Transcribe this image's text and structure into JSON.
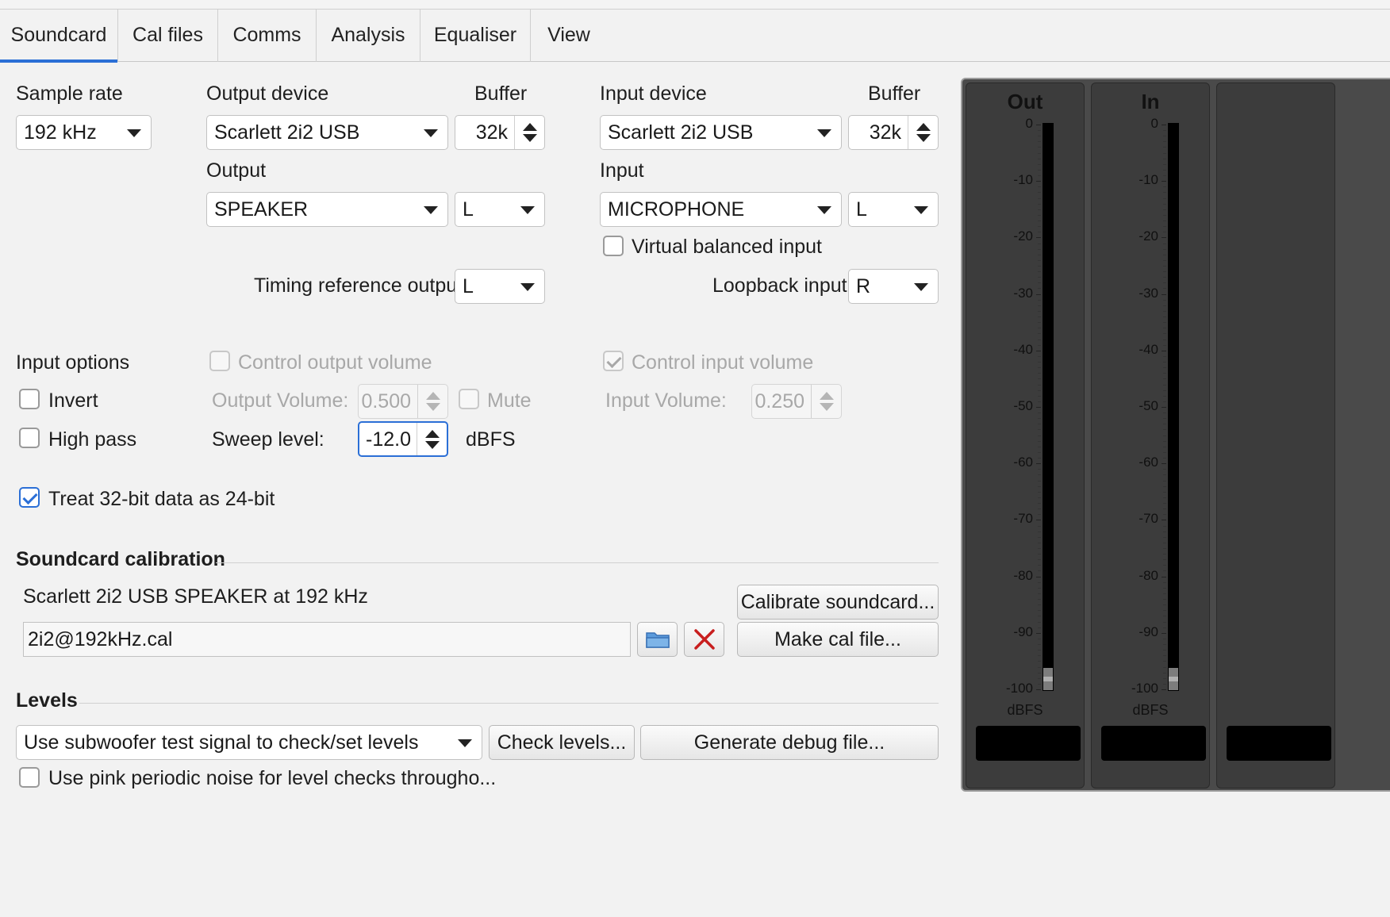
{
  "tabs": [
    "Soundcard",
    "Cal files",
    "Comms",
    "Analysis",
    "Equaliser",
    "View"
  ],
  "sample_rate": {
    "label": "Sample rate",
    "value": "192 kHz"
  },
  "output_device": {
    "label": "Output device",
    "value": "Scarlett 2i2 USB",
    "buffer_label": "Buffer",
    "buffer": "32k"
  },
  "input_device": {
    "label": "Input device",
    "value": "Scarlett 2i2 USB",
    "buffer_label": "Buffer",
    "buffer": "32k"
  },
  "output": {
    "label": "Output",
    "value": "SPEAKER",
    "channel": "L"
  },
  "input": {
    "label": "Input",
    "value": "MICROPHONE",
    "channel": "L"
  },
  "virtual_balanced": {
    "label": "Virtual balanced input",
    "checked": false
  },
  "timing_ref": {
    "label": "Timing reference output",
    "value": "L"
  },
  "loopback": {
    "label": "Loopback input",
    "value": "R"
  },
  "input_options": {
    "label": "Input options",
    "invert": "Invert",
    "high_pass": "High pass",
    "treat_32bit": "Treat 32-bit data as 24-bit"
  },
  "volume": {
    "control_output": "Control output volume",
    "output_volume_label": "Output Volume:",
    "output_volume": "0.500",
    "mute": "Mute",
    "sweep_label": "Sweep level:",
    "sweep_value": "-12.0",
    "sweep_unit": "dBFS",
    "control_input": "Control input volume",
    "input_volume_label": "Input Volume:",
    "input_volume": "0.250"
  },
  "calibration": {
    "heading": "Soundcard calibration",
    "description": "Scarlett 2i2 USB SPEAKER at 192 kHz",
    "calibrate_button": "Calibrate soundcard...",
    "file": "2i2@192kHz.cal",
    "make_button": "Make cal file...",
    "folder_icon": "folder-icon",
    "clear_icon": "close-icon"
  },
  "levels": {
    "heading": "Levels",
    "signal": "Use subwoofer test signal to check/set levels",
    "check_button": "Check levels...",
    "debug_button": "Generate debug file...",
    "pink_noise": "Use pink periodic noise for level checks througho..."
  },
  "meters": {
    "out_title": "Out",
    "in_title": "In",
    "unit": "dBFS",
    "ticks": [
      "0",
      "-10",
      "-20",
      "-30",
      "-40",
      "-50",
      "-60",
      "-70",
      "-80",
      "-90",
      "-100"
    ]
  }
}
